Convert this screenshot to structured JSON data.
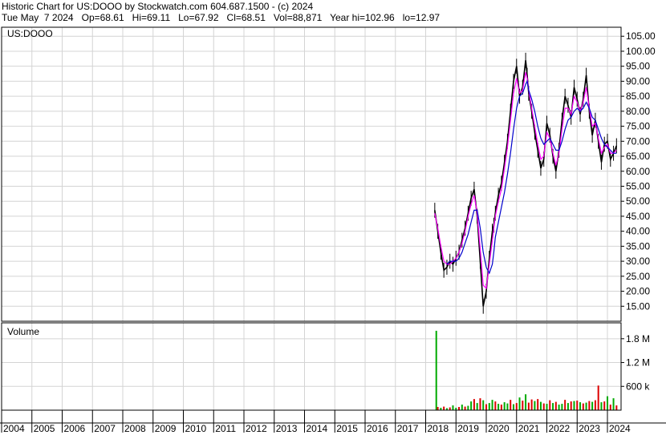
{
  "header": {
    "line1": "Historic Chart for US:DOOO by Stockwatch.com 604.687.1500 - (c) 2024",
    "line2": "Tue May  7 2024   Op=68.61   Hi=69.11   Lo=67.92   Cl=68.51   Vol=88,871   Year hi=102.96   lo=12.97"
  },
  "chart_data": {
    "type": "line",
    "symbol": "US:DOOO",
    "price_panel": {
      "ylim": [
        10,
        108
      ],
      "yticks": [
        "105.00",
        "100.00",
        "95.00",
        "90.00",
        "85.00",
        "80.00",
        "75.00",
        "70.00",
        "65.00",
        "60.00",
        "55.00",
        "50.00",
        "45.00",
        "40.00",
        "35.00",
        "30.00",
        "25.00",
        "20.00",
        "15.00"
      ],
      "x": [
        2018.3,
        2018.4,
        2018.5,
        2018.6,
        2018.7,
        2018.8,
        2018.9,
        2019.0,
        2019.1,
        2019.2,
        2019.3,
        2019.4,
        2019.5,
        2019.6,
        2019.7,
        2019.8,
        2019.9,
        2020.0,
        2020.1,
        2020.2,
        2020.25,
        2020.3,
        2020.4,
        2020.5,
        2020.6,
        2020.7,
        2020.8,
        2020.9,
        2021.0,
        2021.1,
        2021.2,
        2021.3,
        2021.35,
        2021.4,
        2021.5,
        2021.6,
        2021.7,
        2021.8,
        2021.9,
        2022.0,
        2022.1,
        2022.2,
        2022.3,
        2022.4,
        2022.5,
        2022.6,
        2022.7,
        2022.8,
        2022.9,
        2023.0,
        2023.1,
        2023.2,
        2023.3,
        2023.4,
        2023.5,
        2023.6,
        2023.7,
        2023.8,
        2023.9,
        2024.0,
        2024.1,
        2024.2,
        2024.3
      ],
      "series": [
        {
          "values": [
            47,
            40,
            33,
            27,
            28,
            30,
            29,
            31,
            33,
            37,
            41,
            46,
            51,
            54,
            45,
            30,
            15,
            20,
            31,
            40,
            42,
            46,
            52,
            56,
            63,
            70,
            80,
            90,
            95,
            85,
            88,
            97,
            92,
            86,
            80,
            73,
            67,
            61,
            64,
            76,
            72,
            65,
            60,
            67,
            77,
            85,
            82,
            78,
            88,
            84,
            79,
            84,
            92,
            80,
            72,
            77,
            70,
            63,
            69,
            70,
            64,
            66,
            68.5
          ]
        }
      ],
      "moving_averages": [
        {
          "color": "#ff00ff",
          "values": [
            46,
            41,
            35,
            30,
            29,
            29,
            30,
            31,
            33,
            36,
            40,
            45,
            49,
            52,
            46,
            34,
            22,
            21,
            29,
            37,
            41,
            45,
            50,
            54,
            61,
            68,
            77,
            86,
            91,
            86,
            87,
            93,
            91,
            87,
            81,
            75,
            69,
            64,
            65,
            73,
            71,
            66,
            62,
            66,
            74,
            81,
            81,
            79,
            85,
            83,
            80,
            83,
            88,
            81,
            75,
            76,
            71,
            66,
            68,
            69,
            66,
            66,
            67
          ]
        },
        {
          "color": "#0000cc",
          "values": [
            null,
            null,
            null,
            null,
            29,
            30,
            30,
            30,
            31,
            33,
            36,
            39,
            43,
            47,
            47,
            41,
            33,
            28,
            26,
            29,
            33,
            38,
            43,
            48,
            53,
            59,
            66,
            74,
            81,
            85,
            86,
            89,
            90,
            87,
            84,
            80,
            75,
            71,
            69,
            70,
            71,
            69,
            67,
            67,
            70,
            74,
            77,
            78,
            80,
            81,
            80,
            81,
            83,
            81,
            78,
            77,
            74,
            71,
            69,
            68,
            67,
            66,
            66
          ]
        }
      ],
      "year_high": 102.96,
      "year_low": 12.97
    },
    "volume_panel": {
      "label": "Volume",
      "ylim": [
        0,
        2200000
      ],
      "yticks": [
        "1.8 M",
        "1.2 M",
        "600 k"
      ],
      "x": [
        2018.35,
        2018.4,
        2018.5,
        2018.6,
        2018.7,
        2018.8,
        2018.9,
        2019.0,
        2019.1,
        2019.2,
        2019.3,
        2019.4,
        2019.5,
        2019.6,
        2019.7,
        2019.8,
        2019.9,
        2020.0,
        2020.1,
        2020.2,
        2020.3,
        2020.4,
        2020.5,
        2020.6,
        2020.7,
        2020.8,
        2020.9,
        2021.0,
        2021.1,
        2021.2,
        2021.3,
        2021.4,
        2021.5,
        2021.6,
        2021.7,
        2021.8,
        2021.9,
        2022.0,
        2022.1,
        2022.2,
        2022.3,
        2022.4,
        2022.5,
        2022.6,
        2022.7,
        2022.8,
        2022.9,
        2023.0,
        2023.1,
        2023.2,
        2023.3,
        2023.4,
        2023.5,
        2023.6,
        2023.7,
        2023.8,
        2023.9,
        2024.0,
        2024.1,
        2024.2,
        2024.3
      ],
      "values": [
        2000000,
        80000,
        60000,
        90000,
        50000,
        70000,
        120000,
        60000,
        80000,
        140000,
        90000,
        110000,
        220000,
        280000,
        180000,
        300000,
        250000,
        150000,
        180000,
        260000,
        220000,
        160000,
        140000,
        200000,
        170000,
        260000,
        150000,
        180000,
        320000,
        240000,
        400000,
        190000,
        270000,
        230000,
        280000,
        210000,
        170000,
        160000,
        250000,
        180000,
        210000,
        140000,
        160000,
        260000,
        180000,
        220000,
        230000,
        240000,
        200000,
        170000,
        190000,
        230000,
        210000,
        250000,
        620000,
        200000,
        220000,
        350000,
        140000,
        300000,
        120000
      ],
      "colors": [
        "#00aa00",
        "#dd0000",
        "#00aa00",
        "#dd0000",
        "#00aa00",
        "#dd0000",
        "#00aa00",
        "#00aa00",
        "#dd0000",
        "#00aa00",
        "#dd0000",
        "#00aa00",
        "#00aa00",
        "#dd0000",
        "#00aa00",
        "#dd0000",
        "#00aa00",
        "#dd0000",
        "#00aa00",
        "#00aa00",
        "#dd0000",
        "#00aa00",
        "#dd0000",
        "#00aa00",
        "#00aa00",
        "#dd0000",
        "#00aa00",
        "#dd0000",
        "#00aa00",
        "#dd0000",
        "#00aa00",
        "#dd0000",
        "#dd0000",
        "#00aa00",
        "#dd0000",
        "#00aa00",
        "#dd0000",
        "#00aa00",
        "#dd0000",
        "#00aa00",
        "#dd0000",
        "#00aa00",
        "#00aa00",
        "#dd0000",
        "#00aa00",
        "#dd0000",
        "#00aa00",
        "#dd0000",
        "#00aa00",
        "#dd0000",
        "#00aa00",
        "#dd0000",
        "#00aa00",
        "#dd0000",
        "#dd0000",
        "#00aa00",
        "#dd0000",
        "#00aa00",
        "#dd0000",
        "#00aa00",
        "#dd0000"
      ]
    },
    "x_axis": {
      "xlim": [
        2004,
        2024.45
      ],
      "years": [
        "2004",
        "2005",
        "2006",
        "2007",
        "2008",
        "2009",
        "2010",
        "2011",
        "2012",
        "2013",
        "2014",
        "2015",
        "2016",
        "2017",
        "2018",
        "2019",
        "2020",
        "2021",
        "2022",
        "2023",
        "2024"
      ]
    },
    "grid": true
  }
}
